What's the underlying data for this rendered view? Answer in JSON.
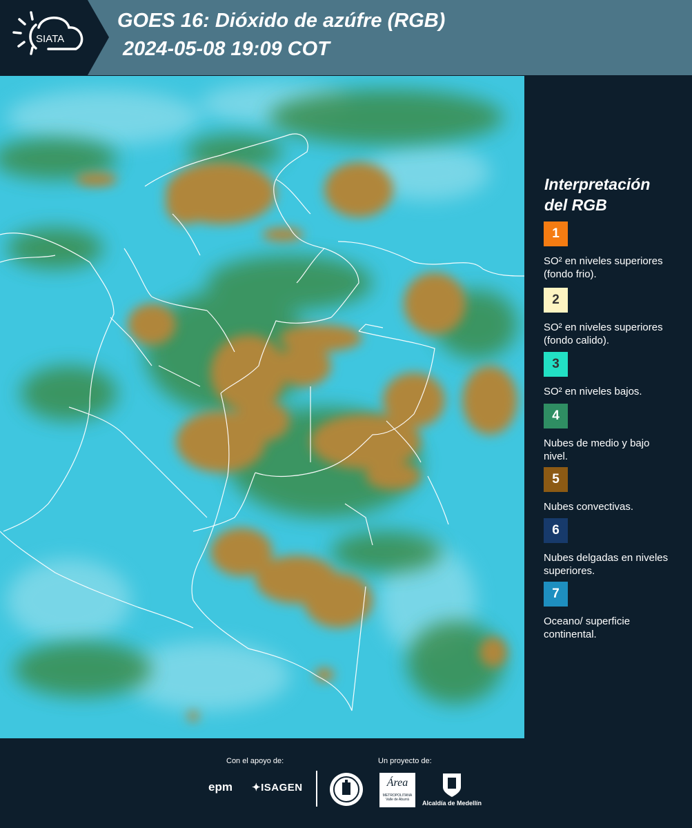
{
  "header": {
    "logo_text": "SIATA",
    "title_line1": "GOES 16: Dióxido de azúfre (RGB)",
    "title_line2": "2024-05-08 19:09 COT"
  },
  "legend": {
    "title_line1": "Interpretación",
    "title_line2": "del RGB",
    "items": [
      {
        "number": "1",
        "color": "#f57c12",
        "text": "SO² en niveles superiores (fondo frio)."
      },
      {
        "number": "2",
        "color": "#fdf4c2",
        "text": "SO² en niveles superiores (fondo calido)."
      },
      {
        "number": "3",
        "color": "#22e0c4",
        "text": "SO² en niveles bajos."
      },
      {
        "number": "4",
        "color": "#2f8e63",
        "text": "Nubes de medio y bajo nivel."
      },
      {
        "number": "5",
        "color": "#8c5a14",
        "text": "Nubes convectivas."
      },
      {
        "number": "6",
        "color": "#173a6b",
        "text": "Nubes delgadas en niveles superiores."
      },
      {
        "number": "7",
        "color": "#1e8fc0",
        "text": "Oceano/ superficie continental."
      }
    ]
  },
  "footer": {
    "support_label": "Con el apoyo de:",
    "project_label": "Un proyecto de:",
    "sponsor1": "epm",
    "sponsor2": "ISAGEN",
    "partner_area": "Área",
    "partner_area_sub": "METROPOLITANA Valle de Aburrá",
    "partner_alcaldia": "Alcaldía de Medellín"
  },
  "map": {
    "ocean_color": "#3fc6df",
    "convective_color": "#b0863a",
    "border_color": "#ffffff"
  }
}
